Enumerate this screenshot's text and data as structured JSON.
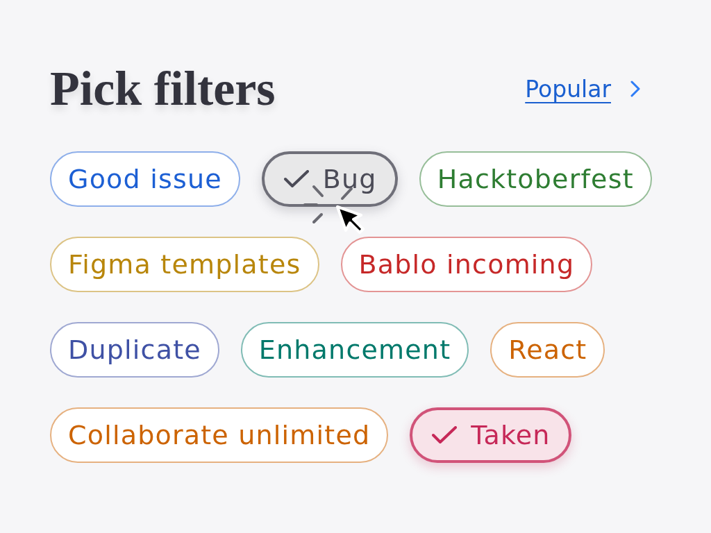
{
  "title": "Pick filters",
  "link": {
    "label": "Popular"
  },
  "chips": [
    {
      "label": "Good issue",
      "color": "#1c5fd4",
      "selected": false
    },
    {
      "label": "Bug",
      "color": "#4b4b57",
      "selected": true
    },
    {
      "label": "Hacktoberfest",
      "color": "#2e7d32",
      "selected": false
    },
    {
      "label": "Figma templates",
      "color": "#b8860b",
      "selected": false
    },
    {
      "label": "Bablo incoming",
      "color": "#c62828",
      "selected": false
    },
    {
      "label": "Duplicate",
      "color": "#3f51a5",
      "selected": false
    },
    {
      "label": "Enhancement",
      "color": "#00796b",
      "selected": false
    },
    {
      "label": "React",
      "color": "#cc6300",
      "selected": false
    },
    {
      "label": "Collaborate unlimited",
      "color": "#cc6300",
      "selected": false
    },
    {
      "label": "Taken",
      "color": "#c62858",
      "selected": true
    }
  ]
}
